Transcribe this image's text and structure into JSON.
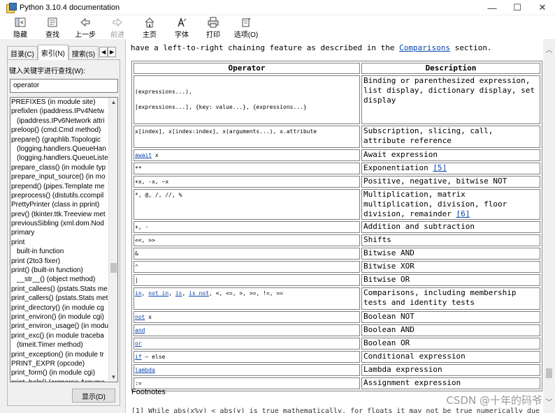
{
  "window": {
    "title": "Python 3.10.4 documentation",
    "min_icon": "minimize-icon",
    "max_icon": "maximize-icon",
    "close_icon": "close-icon",
    "min_glyph": "—",
    "max_glyph": "☐",
    "close_glyph": "✕"
  },
  "toolbar": {
    "hide": "隐藏",
    "find": "查找",
    "back": "上一步",
    "forward": "前进",
    "home": "主页",
    "font": "字体",
    "print": "打印",
    "options": "选项(O)"
  },
  "sidebar": {
    "tabs": [
      "目录(C)",
      "索引(N)",
      "搜索(S)"
    ],
    "keyword_label": "键入关键字进行查找(W):",
    "keyword_value": "operator",
    "display_button": "显示(D)",
    "index_items": [
      {
        "text": "PREFIXES (in module site)",
        "sub": false
      },
      {
        "text": "prefixlen (ipaddress.IPv4Netw",
        "sub": false
      },
      {
        "text": "(ipaddress.IPv6Network attri",
        "sub": true
      },
      {
        "text": "preloop() (cmd.Cmd method)",
        "sub": false
      },
      {
        "text": "prepare() (graphlib.Topologic",
        "sub": false
      },
      {
        "text": "(logging.handlers.QueueHan",
        "sub": true
      },
      {
        "text": "(logging.handlers.QueueListe",
        "sub": true
      },
      {
        "text": "prepare_class() (in module typ",
        "sub": false
      },
      {
        "text": "prepare_input_source() (in mo",
        "sub": false
      },
      {
        "text": "prepend() (pipes.Template me",
        "sub": false
      },
      {
        "text": "preprocess() (distutils.ccompil",
        "sub": false
      },
      {
        "text": "PrettyPrinter (class in pprint)",
        "sub": false
      },
      {
        "text": "prev() (tkinter.ttk.Treeview met",
        "sub": false
      },
      {
        "text": "previousSibling (xml.dom.Nod",
        "sub": false
      },
      {
        "text": "primary",
        "sub": false
      },
      {
        "text": "print",
        "sub": false
      },
      {
        "text": "built-in function",
        "sub": true
      },
      {
        "text": "print (2to3 fixer)",
        "sub": false
      },
      {
        "text": "print() (built-in function)",
        "sub": false
      },
      {
        "text": "__str__() (object method)",
        "sub": true
      },
      {
        "text": "print_callees() (pstats.Stats me",
        "sub": false
      },
      {
        "text": "print_callers() (pstats.Stats met",
        "sub": false
      },
      {
        "text": "print_directory() (in module cg",
        "sub": false
      },
      {
        "text": "print_environ() (in module cgi)",
        "sub": false
      },
      {
        "text": "print_environ_usage() (in modu",
        "sub": false
      },
      {
        "text": "print_exc() (in module traceba",
        "sub": false
      },
      {
        "text": "(timeit.Timer method)",
        "sub": true
      },
      {
        "text": "print_exception() (in module tr",
        "sub": false
      },
      {
        "text": "PRINT_EXPR (opcode)",
        "sub": false
      },
      {
        "text": "print_form() (in module cgi)",
        "sub": false
      },
      {
        "text": "print_help() (argparse.Argume",
        "sub": false
      }
    ]
  },
  "content": {
    "intro_before": "have a left-to-right chaining feature as described in the ",
    "intro_link": "Comparisons",
    "intro_after": " section.",
    "table_headers": {
      "operator": "Operator",
      "description": "Description"
    },
    "rows": [
      {
        "op": [
          [
            {
              "t": "(expressions...),"
            }
          ],
          [
            {
              "t": ""
            }
          ],
          [
            {
              "t": "[expressions...], {key: value...}, {expressions...}"
            }
          ]
        ],
        "desc": [
          {
            "t": "Binding or parenthesized expression, list display, dictionary display, set display"
          }
        ]
      },
      {
        "op": [
          [
            {
              "t": "x[index], x[index:index], x(arguments...), x.attribute"
            }
          ]
        ],
        "desc": [
          {
            "t": "Subscription, slicing, call, attribute reference"
          }
        ]
      },
      {
        "op": [
          [
            {
              "t": "await",
              "link": true
            },
            {
              "t": " x"
            }
          ]
        ],
        "desc": [
          {
            "t": "Await expression"
          }
        ]
      },
      {
        "op": [
          [
            {
              "t": "**"
            }
          ]
        ],
        "desc": [
          {
            "t": "Exponentiation "
          },
          {
            "t": "[5]",
            "link": true
          }
        ]
      },
      {
        "op": [
          [
            {
              "t": "+x, -x, ~x"
            }
          ]
        ],
        "desc": [
          {
            "t": "Positive, negative, bitwise NOT"
          }
        ]
      },
      {
        "op": [
          [
            {
              "t": "*, @, /, //, %"
            }
          ]
        ],
        "desc": [
          {
            "t": "Multiplication, matrix multiplication, division, floor division, remainder "
          },
          {
            "t": "[6]",
            "link": true
          }
        ]
      },
      {
        "op": [
          [
            {
              "t": "+, -"
            }
          ]
        ],
        "desc": [
          {
            "t": "Addition and subtraction"
          }
        ]
      },
      {
        "op": [
          [
            {
              "t": "<<, >>"
            }
          ]
        ],
        "desc": [
          {
            "t": "Shifts"
          }
        ]
      },
      {
        "op": [
          [
            {
              "t": "&"
            }
          ]
        ],
        "desc": [
          {
            "t": "Bitwise AND"
          }
        ]
      },
      {
        "op": [
          [
            {
              "t": "^"
            }
          ]
        ],
        "desc": [
          {
            "t": "Bitwise XOR"
          }
        ]
      },
      {
        "op": [
          [
            {
              "t": "|"
            }
          ]
        ],
        "desc": [
          {
            "t": "Bitwise OR"
          }
        ]
      },
      {
        "op": [
          [
            {
              "t": "in",
              "link": true
            },
            {
              "t": ", "
            },
            {
              "t": "not in",
              "link": true
            },
            {
              "t": ", "
            },
            {
              "t": "is",
              "link": true
            },
            {
              "t": ", "
            },
            {
              "t": "is not",
              "link": true
            },
            {
              "t": ", <, <=, >, >=, !=, =="
            }
          ]
        ],
        "desc": [
          {
            "t": "Comparisons, including membership tests and identity tests"
          }
        ]
      },
      {
        "op": [
          [
            {
              "t": "not",
              "link": true
            },
            {
              "t": " x"
            }
          ]
        ],
        "desc": [
          {
            "t": "Boolean NOT"
          }
        ]
      },
      {
        "op": [
          [
            {
              "t": "and",
              "link": true
            }
          ]
        ],
        "desc": [
          {
            "t": "Boolean AND"
          }
        ]
      },
      {
        "op": [
          [
            {
              "t": "or",
              "link": true
            }
          ]
        ],
        "desc": [
          {
            "t": "Boolean OR"
          }
        ]
      },
      {
        "op": [
          [
            {
              "t": "if",
              "link": true
            },
            {
              "t": " – else"
            }
          ]
        ],
        "desc": [
          {
            "t": "Conditional expression"
          }
        ]
      },
      {
        "op": [
          [
            {
              "t": "lambda",
              "link": true
            }
          ]
        ],
        "desc": [
          {
            "t": "Lambda expression"
          }
        ]
      },
      {
        "op": [
          [
            {
              "t": ":="
            }
          ]
        ],
        "desc": [
          {
            "t": "Assignment expression"
          }
        ]
      }
    ],
    "footnotes_heading": "Footnotes",
    "footnote_partial": "[1] While abs(x%y) < abs(y) is true mathematically, for floats it may not be true numerically due"
  },
  "watermark": "CSDN @十年的码爷"
}
